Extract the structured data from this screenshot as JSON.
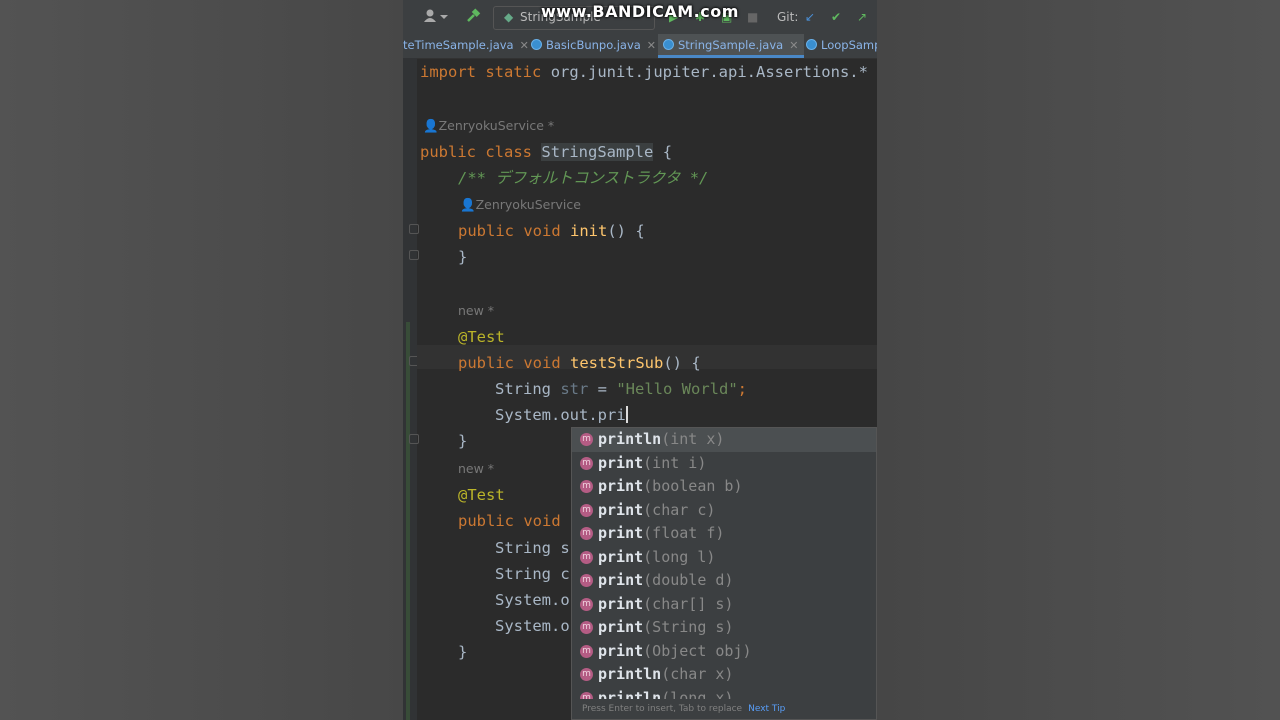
{
  "watermark": "www.BANDICAM.com",
  "toolbar": {
    "run_config": "StringSample",
    "git_label": "Git:"
  },
  "tabs": [
    {
      "label": "teTimeSample.java",
      "active": false
    },
    {
      "label": "BasicBunpo.java",
      "active": false
    },
    {
      "label": "StringSample.java",
      "active": true
    },
    {
      "label": "LoopSamp",
      "active": false
    }
  ],
  "editor": {
    "import_kw1": "import",
    "import_kw2": "static",
    "import_rest": "org.junit.jupiter.api.Assertions.*",
    "hint_author1": "ZenryokuService *",
    "class_public": "public",
    "class_kw": "class",
    "class_name": "StringSample",
    "brace_open": "{",
    "comment": "/** デフォルトコンストラクタ */",
    "hint_author2": "ZenryokuService",
    "init_public": "public",
    "init_void": "void",
    "init_name": "init",
    "init_rest": "() {",
    "close_brace": "}",
    "hint_new1": "new *",
    "annotation1": "@Test",
    "m1_public": "public",
    "m1_void": "void",
    "m1_name": "testStrSub",
    "m1_rest": "() {",
    "l_string": "String",
    "l_str": "str",
    "l_eq": " = ",
    "l_strval": "\"Hello World\"",
    "l_semi": ";",
    "l_sysout": "System.out.pri",
    "close_brace2": "}",
    "hint_new2": "new *",
    "annotation2": "@Test",
    "m2_public": "public",
    "m2_void": "void",
    "l2_a": "String s",
    "l2_b": "String c",
    "l2_c": "System.o",
    "l2_d": "System.o",
    "close_brace3": "}"
  },
  "completion": {
    "items": [
      {
        "icon": "m",
        "match": "pri",
        "rest": "ntln",
        "params": "(int x)"
      },
      {
        "icon": "m",
        "match": "pri",
        "rest": "nt",
        "params": "(int i)"
      },
      {
        "icon": "m",
        "match": "pri",
        "rest": "nt",
        "params": "(boolean b)"
      },
      {
        "icon": "m",
        "match": "pri",
        "rest": "nt",
        "params": "(char c)"
      },
      {
        "icon": "m",
        "match": "pri",
        "rest": "nt",
        "params": "(float f)"
      },
      {
        "icon": "m",
        "match": "pri",
        "rest": "nt",
        "params": "(long l)"
      },
      {
        "icon": "m",
        "match": "pri",
        "rest": "nt",
        "params": "(double d)"
      },
      {
        "icon": "m",
        "match": "pri",
        "rest": "nt",
        "params": "(char[] s)"
      },
      {
        "icon": "m",
        "match": "pri",
        "rest": "nt",
        "params": "(String s)"
      },
      {
        "icon": "m",
        "match": "pri",
        "rest": "nt",
        "params": "(Object obj)"
      },
      {
        "icon": "m",
        "match": "pri",
        "rest": "ntln",
        "params": "(char x)"
      },
      {
        "icon": "m",
        "match": "pri",
        "rest": "ntln",
        "params": "(long x)"
      }
    ],
    "footer_text": "Press Enter to insert, Tab to replace",
    "footer_link": "Next Tip"
  }
}
